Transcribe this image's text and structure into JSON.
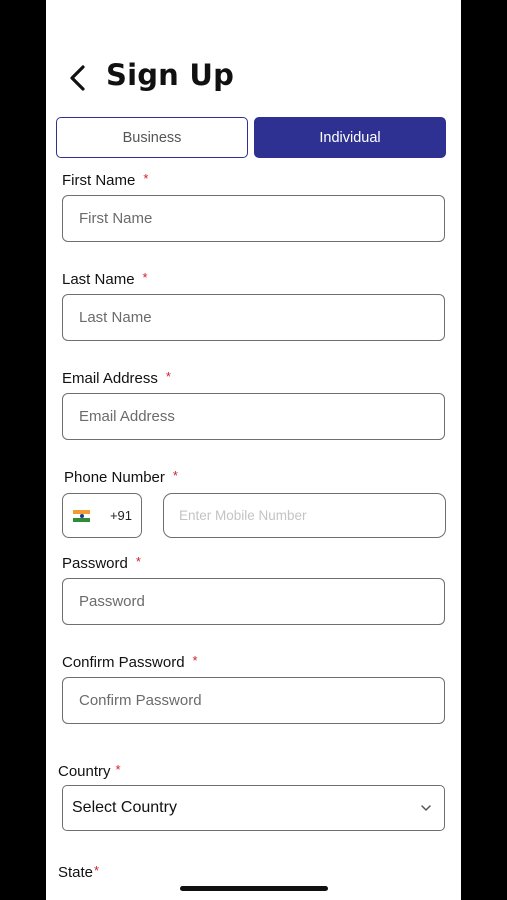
{
  "header": {
    "title": "Sign Up",
    "back_icon": "chevron-left-icon"
  },
  "tabs": [
    {
      "label": "Business",
      "selected": false
    },
    {
      "label": "Individual",
      "selected": true
    }
  ],
  "form": {
    "required_marker": "*",
    "first_name": {
      "label": "First Name",
      "placeholder": "First Name"
    },
    "last_name": {
      "label": "Last Name",
      "placeholder": "Last Name"
    },
    "email": {
      "label": "Email Address",
      "placeholder": "Email Address"
    },
    "phone": {
      "label": "Phone Number",
      "country_code": "+91",
      "country_flag": "india-flag-icon",
      "placeholder": "Enter Mobile Number"
    },
    "password": {
      "label": "Password",
      "placeholder": "Password"
    },
    "confirm_password": {
      "label": "Confirm Password",
      "placeholder": "Confirm Password"
    },
    "country": {
      "label": "Country",
      "selected_value": "Select Country"
    },
    "state": {
      "label": "State"
    }
  },
  "colors": {
    "accent": "#2e3191",
    "required": "#d3202a",
    "border": "#6f6f6f",
    "background": "#ffffff"
  }
}
